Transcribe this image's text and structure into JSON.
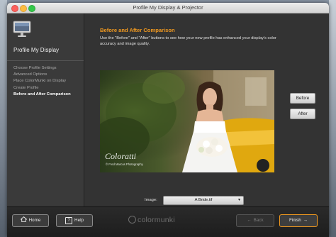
{
  "window": {
    "title": "Profile My Display & Projector"
  },
  "sidebar": {
    "title": "Profile My Display",
    "steps": [
      {
        "label": "Choose Profile Settings"
      },
      {
        "label": "Advanced Options"
      },
      {
        "label": "Place ColorMunki on Display"
      },
      {
        "label": "Create Profile"
      },
      {
        "label": "Before and After Comparison",
        "active": true
      }
    ]
  },
  "main": {
    "heading": "Before and After Comparison",
    "description": "Use the \"Before\" and \"After\" buttons to see how your new profile has enhanced your display's color accuracy and image quality.",
    "watermark": "Coloratti",
    "credit": "© Fred Marcus Photography",
    "before_label": "Before",
    "after_label": "After",
    "image_label": "Image:",
    "image_selected": "A Bride.tif"
  },
  "footer": {
    "home_label": "Home",
    "help_label": "Help",
    "brand": "colormunki",
    "back_label": "Back",
    "finish_label": "Finish"
  },
  "colors": {
    "accent": "#f39a1f",
    "window_bg": "#333333",
    "sidebar_bg": "#3a3a3a"
  },
  "icons": {
    "home": "house-icon",
    "help": "question-icon",
    "back": "arrow-left-icon",
    "finish": "arrow-right-icon",
    "monitor": "monitor-icon"
  }
}
